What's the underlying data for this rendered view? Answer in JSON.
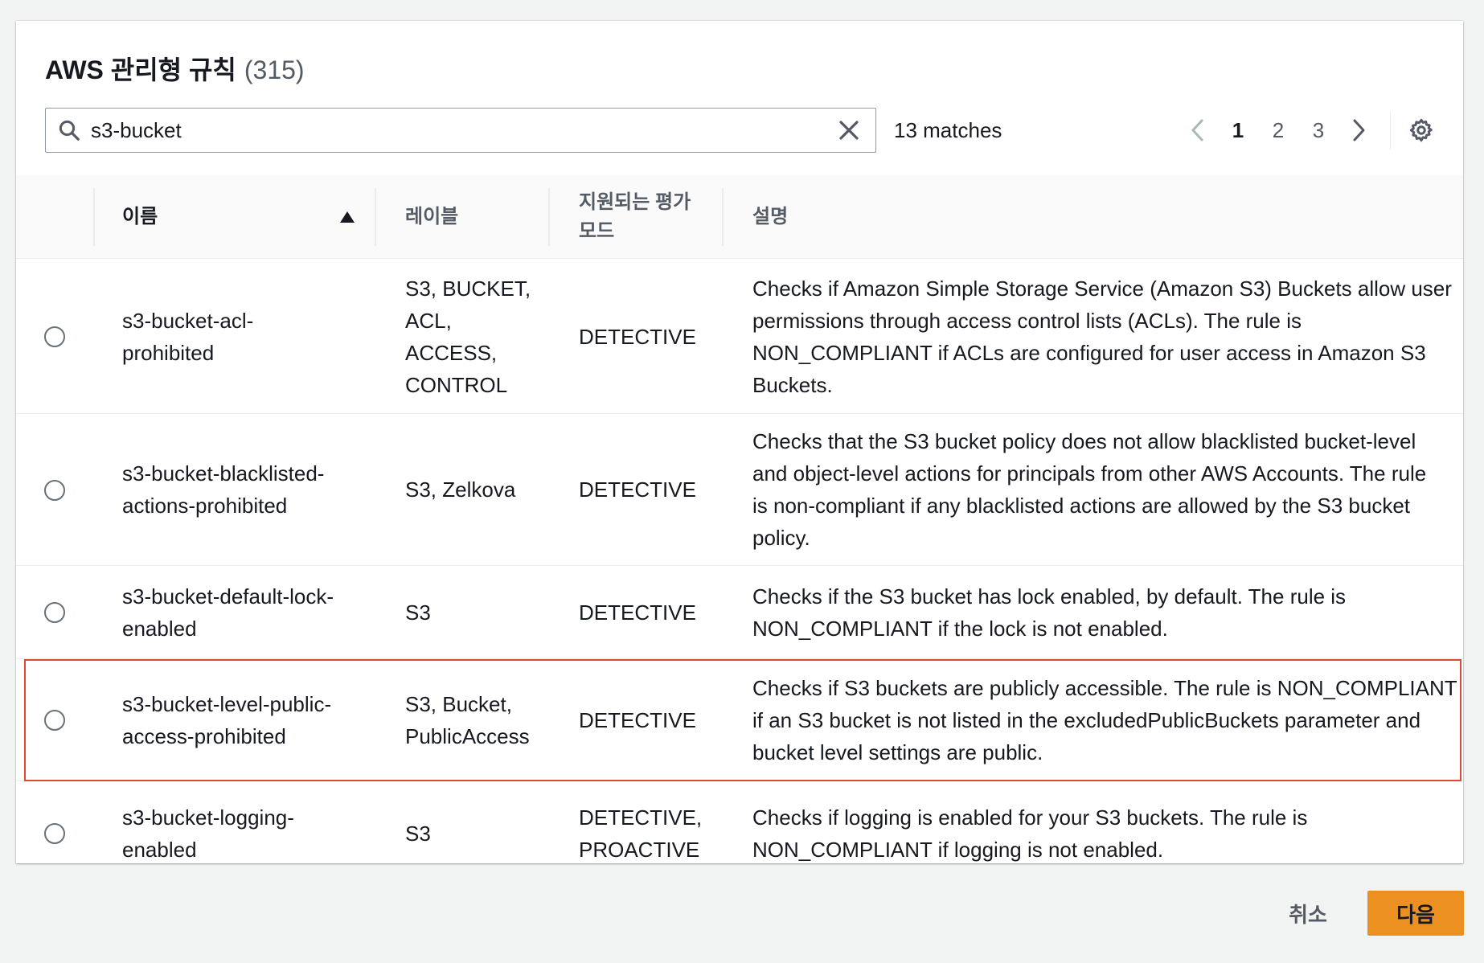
{
  "header": {
    "title": "AWS 관리형 규칙",
    "count": "(315)"
  },
  "search": {
    "value": "s3-bucket",
    "matches": "13 matches"
  },
  "pagination": {
    "pages": [
      "1",
      "2",
      "3"
    ],
    "current": "1"
  },
  "table": {
    "columns": {
      "name": "이름",
      "labels": "레이블",
      "eval_mode_line1": "지원되는 평가",
      "eval_mode_line2": "모드",
      "description": "설명"
    },
    "sort": "ascending",
    "rows": [
      {
        "name": [
          "s3-bucket-acl-",
          "prohibited"
        ],
        "labels": [
          "S3, BUCKET,",
          "ACL,",
          "ACCESS,",
          "CONTROL"
        ],
        "mode": [
          "DETECTIVE"
        ],
        "description": [
          "Checks if Amazon Simple Storage Service (Amazon S3) Buckets allow user",
          "permissions through access control lists (ACLs). The rule is",
          "NON_COMPLIANT if ACLs are configured for user access in Amazon S3",
          "Buckets."
        ]
      },
      {
        "name": [
          "s3-bucket-blacklisted-",
          "actions-prohibited"
        ],
        "labels": [
          "S3, Zelkova"
        ],
        "mode": [
          "DETECTIVE"
        ],
        "description": [
          "Checks that the S3 bucket policy does not allow blacklisted bucket-level",
          "and object-level actions for principals from other AWS Accounts. The rule",
          "is non-compliant if any blacklisted actions are allowed by the S3 bucket",
          "policy."
        ]
      },
      {
        "name": [
          "s3-bucket-default-lock-",
          "enabled"
        ],
        "labels": [
          "S3"
        ],
        "mode": [
          "DETECTIVE"
        ],
        "description": [
          "Checks if the S3 bucket has lock enabled, by default. The rule is",
          "NON_COMPLIANT if the lock is not enabled."
        ]
      },
      {
        "name": [
          "s3-bucket-level-public-",
          "access-prohibited"
        ],
        "labels": [
          "S3, Bucket,",
          "PublicAccess"
        ],
        "mode": [
          "DETECTIVE"
        ],
        "description": [
          "Checks if S3 buckets are publicly accessible. The rule is NON_COMPLIANT",
          "if an S3 bucket is not listed in the excludedPublicBuckets parameter and",
          "bucket level settings are public."
        ]
      },
      {
        "name": [
          "s3-bucket-logging-",
          "enabled"
        ],
        "labels": [
          "S3"
        ],
        "mode": [
          "DETECTIVE,",
          "PROACTIVE"
        ],
        "description": [
          "Checks if logging is enabled for your S3 buckets. The rule is",
          "NON_COMPLIANT if logging is not enabled."
        ]
      }
    ]
  },
  "footer": {
    "cancel": "취소",
    "next": "다음"
  },
  "colors": {
    "primary_button": "#ec9121",
    "highlight_border": "#e0492f",
    "page_background": "#f2f3f3"
  },
  "icons": [
    "search-icon",
    "clear-icon",
    "chevron-left-icon",
    "chevron-right-icon",
    "settings-gear-icon",
    "sort-ascending-icon"
  ]
}
